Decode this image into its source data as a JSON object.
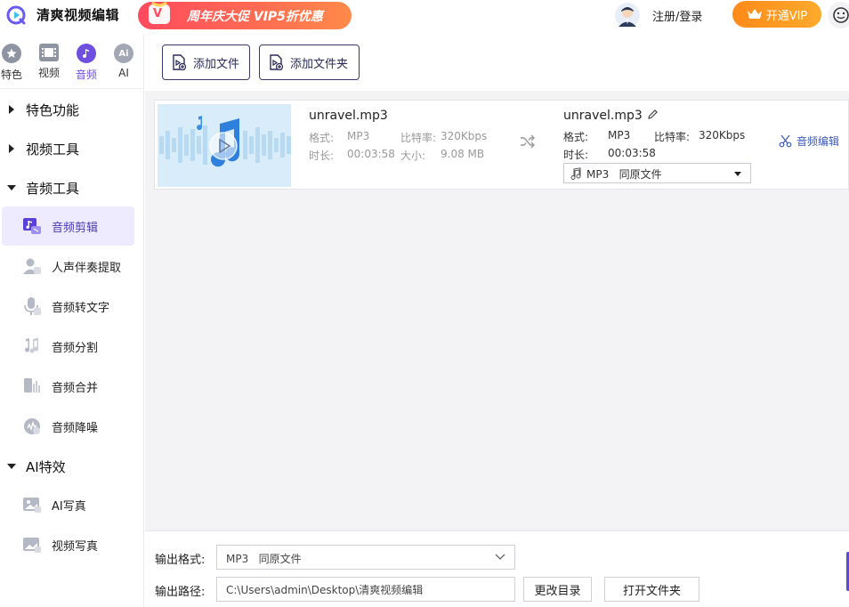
{
  "app": {
    "title": "清爽视频编辑",
    "promo_badge": "V",
    "promo_text": "周年庆大促 VIP5折优惠",
    "login": "注册/登录",
    "vip_button": "开通VIP"
  },
  "sidebar": {
    "categories": [
      {
        "label": "特色",
        "icon": "star-icon",
        "active": false
      },
      {
        "label": "视频",
        "icon": "film-icon",
        "active": false
      },
      {
        "label": "音频",
        "icon": "music-note-icon",
        "active": true
      },
      {
        "label": "AI",
        "icon": "ai-icon",
        "active": false
      }
    ],
    "groups": {
      "featured": "特色功能",
      "video_tools": "视频工具",
      "audio_tools": "音频工具",
      "ai_effects": "AI特效"
    },
    "audio_items": [
      {
        "label": "音频剪辑",
        "icon": "audio-clip-icon",
        "active": true
      },
      {
        "label": "人声伴奏提取",
        "icon": "vocal-extract-icon",
        "active": false
      },
      {
        "label": "音频转文字",
        "icon": "microphone-icon",
        "active": false
      },
      {
        "label": "音频分割",
        "icon": "audio-split-icon",
        "active": false
      },
      {
        "label": "音频合并",
        "icon": "audio-merge-icon",
        "active": false
      },
      {
        "label": "音频降噪",
        "icon": "noise-reduction-icon",
        "active": false
      }
    ],
    "ai_items": [
      {
        "label": "AI写真",
        "icon": "ai-portrait-icon",
        "active": false
      },
      {
        "label": "视频写真",
        "icon": "video-portrait-icon",
        "active": false
      }
    ]
  },
  "toolbar": {
    "add_file": "添加文件",
    "add_folder": "添加文件夹"
  },
  "file": {
    "source": {
      "name": "unravel.mp3",
      "format_label": "格式:",
      "format_value": "MP3",
      "bitrate_label": "比特率:",
      "bitrate_value": "320Kbps",
      "duration_label": "时长:",
      "duration_value": "00:03:58",
      "size_label": "大小:",
      "size_value": "9.08 MB"
    },
    "output": {
      "name": "unravel.mp3",
      "format_label": "格式:",
      "format_value": "MP3",
      "bitrate_label": "比特率:",
      "bitrate_value": "320Kbps",
      "duration_label": "时长:",
      "duration_value": "00:03:58",
      "format_select": "MP3   同原文件"
    },
    "edit_audio": "音频编辑"
  },
  "bottom": {
    "output_format_label": "输出格式:",
    "output_format_value": "MP3   同原文件",
    "output_path_label": "输出路径:",
    "output_path_value": "C:\\Users\\admin\\Desktop\\清爽视频编辑",
    "change_dir": "更改目录",
    "open_folder": "打开文件夹"
  },
  "colors": {
    "accent": "#6f4fe0",
    "vip_orange": "#ff9a22",
    "promo_red": "#ff4a5e",
    "link_blue": "#3a58b8"
  }
}
